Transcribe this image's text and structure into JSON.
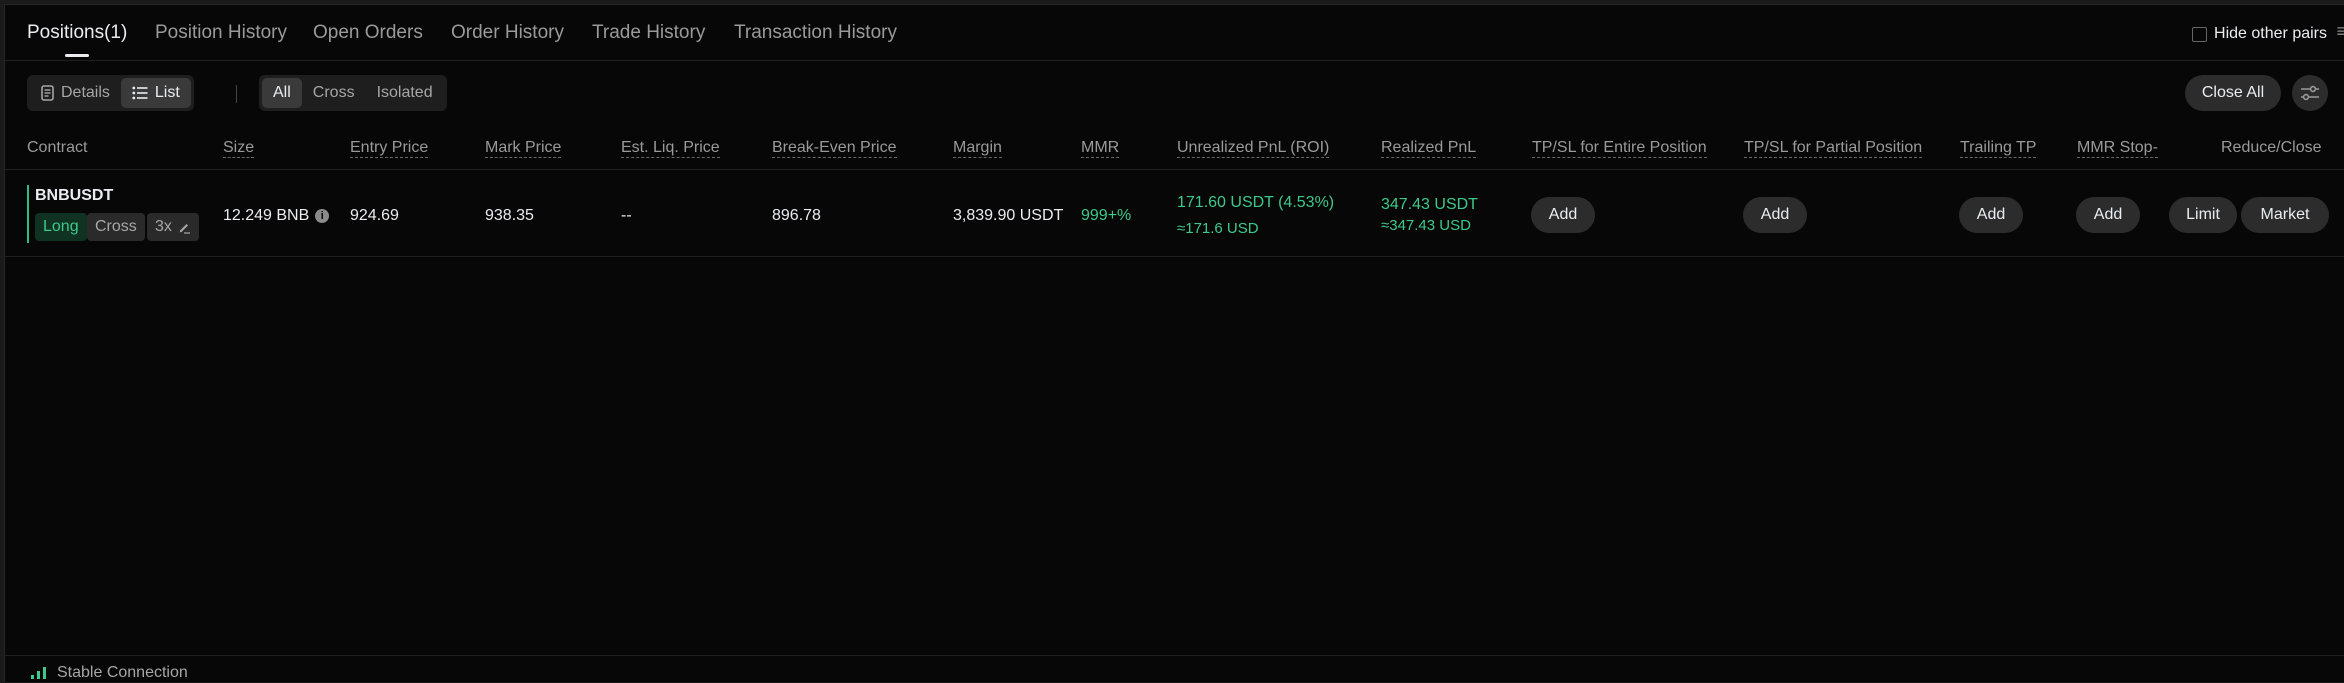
{
  "tabs": [
    {
      "label": "Positions(1)",
      "active": true
    },
    {
      "label": "Position History"
    },
    {
      "label": "Open Orders"
    },
    {
      "label": "Order History"
    },
    {
      "label": "Trade History"
    },
    {
      "label": "Transaction History"
    }
  ],
  "hide_other_pairs": {
    "label": "Hide other pairs",
    "checked": false
  },
  "view_toggle": {
    "details": "Details",
    "list": "List",
    "active": "list"
  },
  "margin_filter": {
    "all": "All",
    "cross": "Cross",
    "isolated": "Isolated",
    "active": "all"
  },
  "close_all_label": "Close All",
  "columns": {
    "contract": "Contract",
    "size": "Size",
    "entry_price": "Entry Price",
    "mark_price": "Mark Price",
    "est_liq_price": "Est. Liq. Price",
    "break_even_price": "Break-Even Price",
    "margin": "Margin",
    "mmr": "MMR",
    "unrealized_pnl": "Unrealized PnL (ROI)",
    "realized_pnl": "Realized PnL",
    "tpsl_entire": "TP/SL for Entire Position",
    "tpsl_partial": "TP/SL for Partial Position",
    "trailing_tp": "Trailing TP",
    "mmr_stop": "MMR Stop-",
    "reduce_close": "Reduce/Close"
  },
  "position": {
    "contract": "BNBUSDT",
    "side": "Long",
    "margin_mode": "Cross",
    "leverage": "3x",
    "size": "12.249 BNB",
    "entry_price": "924.69",
    "mark_price": "938.35",
    "est_liq_price": "--",
    "break_even_price": "896.78",
    "margin": "3,839.90 USDT",
    "mmr": "999+%",
    "unrealized_pnl": "171.60 USDT (4.53%)",
    "unrealized_pnl_usd": "≈171.6 USD",
    "realized_pnl": "347.43 USDT",
    "realized_pnl_usd": "≈347.43 USD",
    "add_label": "Add",
    "limit_label": "Limit",
    "market_label": "Market"
  },
  "footer": {
    "connection": "Stable Connection"
  },
  "colors": {
    "profit": "#3ec98c",
    "background": "#070707",
    "button": "#2c2c2c"
  },
  "icons": [
    "details-icon",
    "list-icon",
    "info-icon",
    "edit-icon",
    "filter-settings-icon",
    "signal-icon"
  ]
}
